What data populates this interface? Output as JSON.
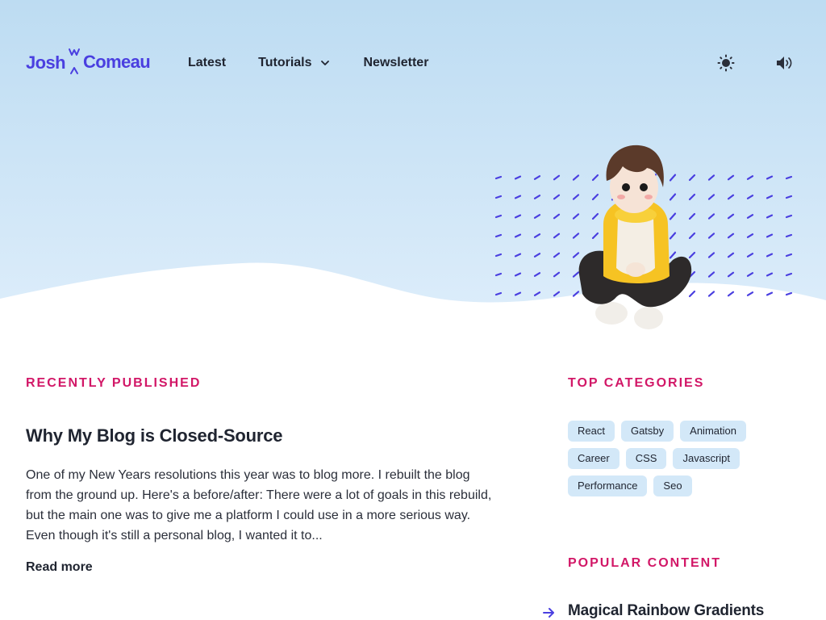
{
  "header": {
    "logo": {
      "first": "Josh",
      "last": "Comeau"
    },
    "nav": [
      {
        "label": "Latest"
      },
      {
        "label": "Tutorials"
      },
      {
        "label": "Newsletter"
      }
    ],
    "actions": {
      "theme_icon": "sun-icon",
      "sound_icon": "speaker-icon"
    }
  },
  "recent": {
    "heading": "Recently Published",
    "post": {
      "title": "Why My Blog is Closed-Source",
      "excerpt": "One of my New Years resolutions this year was to blog more. I rebuilt the blog from the ground up. Here's a before/after: There were a lot of goals in this rebuild, but the main one was to give me a platform I could use in a more serious way. Even though it's still a personal blog, I wanted it to...",
      "read_more": "Read more"
    }
  },
  "sidebar": {
    "categories_heading": "Top Categories",
    "categories": [
      "React",
      "Gatsby",
      "Animation",
      "Career",
      "CSS",
      "Javascript",
      "Performance",
      "Seo"
    ],
    "popular_heading": "Popular Content",
    "popular": [
      {
        "label": "Magical Rainbow Gradients"
      }
    ]
  },
  "colors": {
    "accent": "#4a3fe0",
    "section_heading": "#d21767",
    "hero_top": "#bddcf2",
    "hero_bottom": "#d9ebf9",
    "tag_bg": "#d3e8f8"
  }
}
